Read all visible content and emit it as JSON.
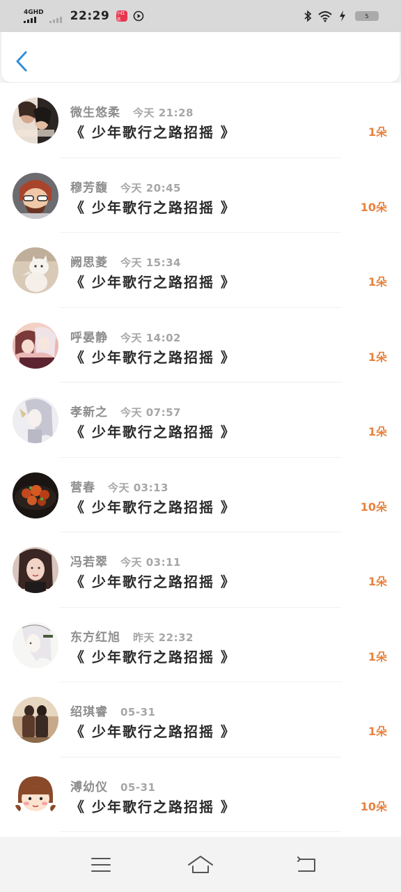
{
  "status_bar": {
    "network": "4GHD",
    "time": "22:29",
    "app_badge": "小红书",
    "battery": "5",
    "icons": [
      "signal-icon",
      "bluetooth-icon",
      "wifi-icon",
      "charging-icon",
      "battery-icon"
    ]
  },
  "header": {
    "back_icon": "chevron-left-icon",
    "accent_color": "#2f8fd8"
  },
  "list": {
    "items": [
      {
        "name": "微生悠柔",
        "date": "今天 21:28",
        "title": "《 少年歌行之路招摇 》",
        "count": "1朵"
      },
      {
        "name": "穆芳馥",
        "date": "今天 20:45",
        "title": "《 少年歌行之路招摇 》",
        "count": "10朵"
      },
      {
        "name": "阙思菱",
        "date": "今天 15:34",
        "title": "《 少年歌行之路招摇 》",
        "count": "1朵"
      },
      {
        "name": "呼晏静",
        "date": "今天 14:02",
        "title": "《 少年歌行之路招摇 》",
        "count": "1朵"
      },
      {
        "name": "孝新之",
        "date": "今天 07:57",
        "title": "《 少年歌行之路招摇 》",
        "count": "1朵"
      },
      {
        "name": "营春",
        "date": "今天 03:13",
        "title": "《 少年歌行之路招摇 》",
        "count": "10朵"
      },
      {
        "name": "冯若翠",
        "date": "今天 03:11",
        "title": "《 少年歌行之路招摇 》",
        "count": "1朵"
      },
      {
        "name": "东方红旭",
        "date": "昨天 22:32",
        "title": "《 少年歌行之路招摇 》",
        "count": "1朵"
      },
      {
        "name": "绍琪睿",
        "date": "05-31",
        "title": "《 少年歌行之路招摇 》",
        "count": "1朵"
      },
      {
        "name": "溥幼仪",
        "date": "05-31",
        "title": "《 少年歌行之路招摇 》",
        "count": "10朵"
      }
    ],
    "count_color": "#e8823f"
  },
  "nav_bar": {
    "icons": [
      "menu-icon",
      "home-icon",
      "back-icon"
    ]
  }
}
